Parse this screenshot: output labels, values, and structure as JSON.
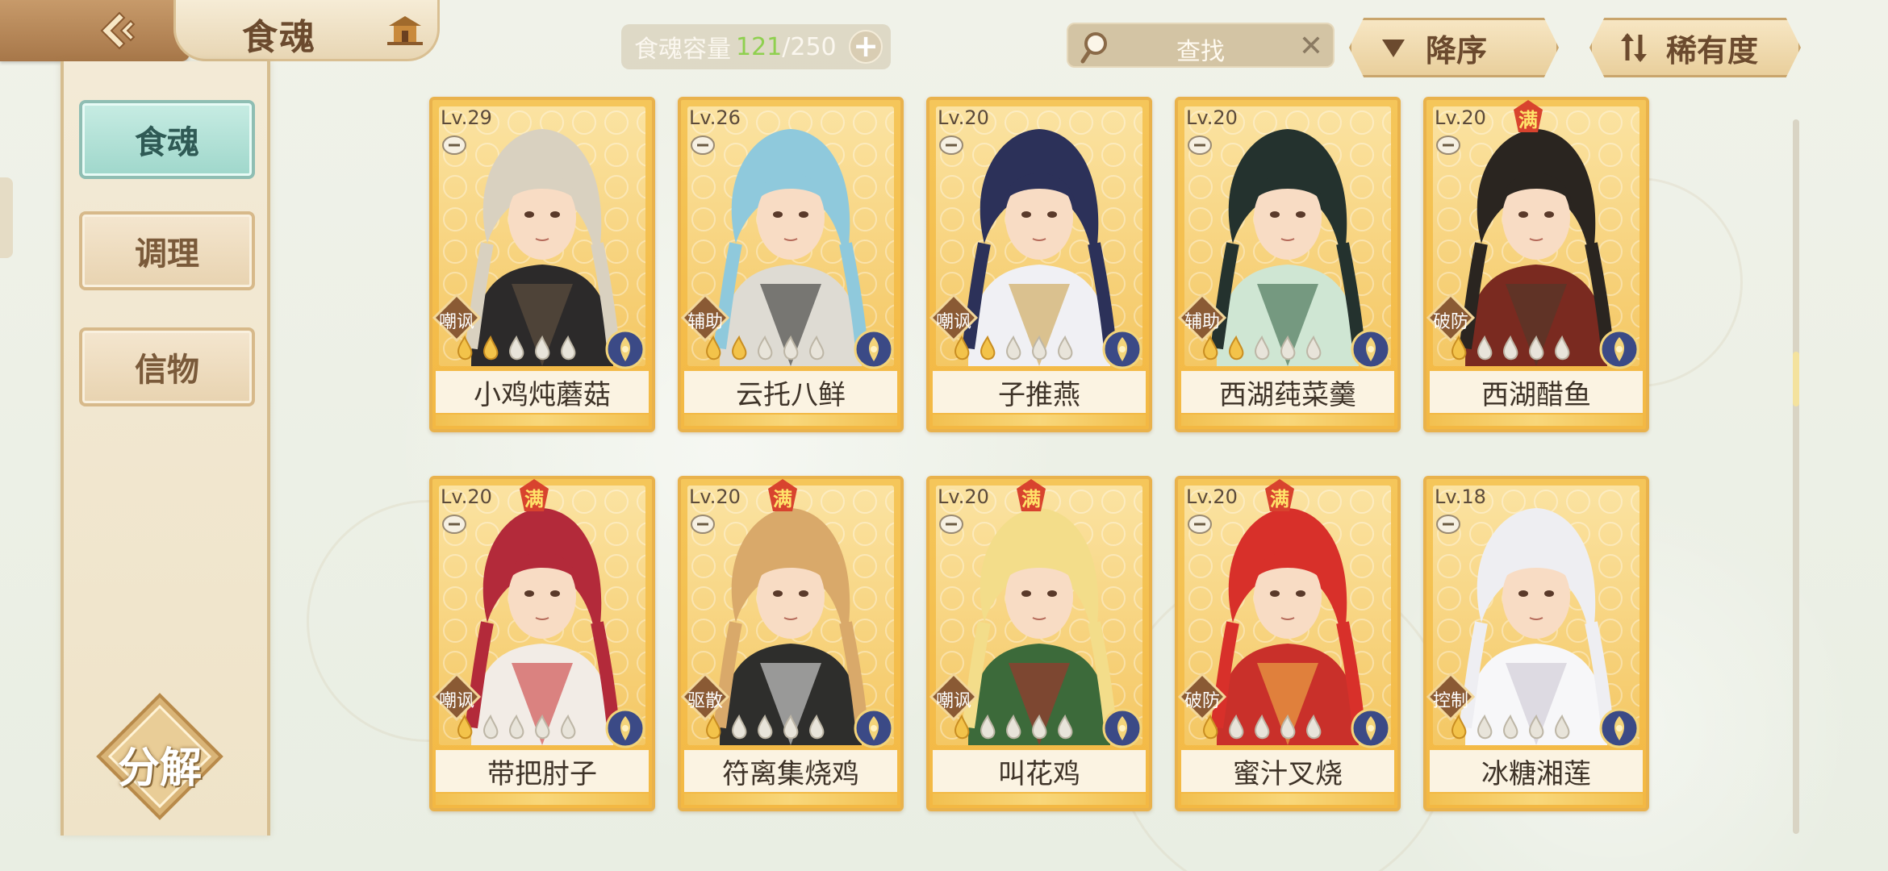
{
  "header": {
    "title": "食魂",
    "capacity_label": "食魂容量",
    "capacity_current": "121",
    "capacity_sep": "/",
    "capacity_max": "250",
    "search_placeholder": "查找",
    "sort_order_label": "降序",
    "sort_by_label": "稀有度"
  },
  "sidebar": {
    "items": [
      {
        "label": "食魂",
        "active": true
      },
      {
        "label": "调理",
        "active": false
      },
      {
        "label": "信物",
        "active": false
      }
    ],
    "decompose_label": "分解"
  },
  "badges": {
    "max_text": "满"
  },
  "cards": [
    {
      "level": "Lv.29",
      "name": "小鸡炖蘑菇",
      "role": "嘲讽",
      "stars": 2,
      "maxed": false,
      "hair": "#d9d1c0",
      "cloth": "#2c2a2a",
      "accent": "#6b5843"
    },
    {
      "level": "Lv.26",
      "name": "云托八鲜",
      "role": "辅助",
      "stars": 2,
      "maxed": false,
      "hair": "#8fc9dc",
      "cloth": "#dedbd3",
      "accent": "#222"
    },
    {
      "level": "Lv.20",
      "name": "子推燕",
      "role": "嘲讽",
      "stars": 2,
      "maxed": false,
      "hair": "#2c3159",
      "cloth": "#f0f0f4",
      "accent": "#c99a3c"
    },
    {
      "level": "Lv.20",
      "name": "西湖莼菜羹",
      "role": "辅助",
      "stars": 2,
      "maxed": false,
      "hair": "#24322e",
      "cloth": "#cfe6d3",
      "accent": "#2c5a3c"
    },
    {
      "level": "Lv.20",
      "name": "西湖醋鱼",
      "role": "破防",
      "stars": 1,
      "maxed": true,
      "hair": "#2a2520",
      "cloth": "#7a2a20",
      "accent": "#4a3b2b"
    },
    {
      "level": "Lv.20",
      "name": "带把肘子",
      "role": "嘲讽",
      "stars": 1,
      "maxed": true,
      "hair": "#b32a3a",
      "cloth": "#f2ece6",
      "accent": "#c62c2c"
    },
    {
      "level": "Lv.20",
      "name": "符离集烧鸡",
      "role": "驱散",
      "stars": 1,
      "maxed": true,
      "hair": "#d9a96a",
      "cloth": "#2e2e2c",
      "accent": "#f2f2f2"
    },
    {
      "level": "Lv.20",
      "name": "叫花鸡",
      "role": "嘲讽",
      "stars": 1,
      "maxed": true,
      "hair": "#f3dd8a",
      "cloth": "#3c6a3a",
      "accent": "#b32a2a"
    },
    {
      "level": "Lv.20",
      "name": "蜜汁叉烧",
      "role": "破防",
      "stars": 1,
      "maxed": true,
      "hair": "#d8302a",
      "cloth": "#c9302a",
      "accent": "#f3c24a"
    },
    {
      "level": "Lv.18",
      "name": "冰糖湘莲",
      "role": "控制",
      "stars": 1,
      "maxed": false,
      "hair": "#eeeef2",
      "cloth": "#f7f7f9",
      "accent": "#c9c3cf"
    }
  ],
  "colors": {
    "capacity_current": "#8fd04f",
    "card_gold": "#f3b843",
    "active_tab": "#9fd7cb"
  }
}
